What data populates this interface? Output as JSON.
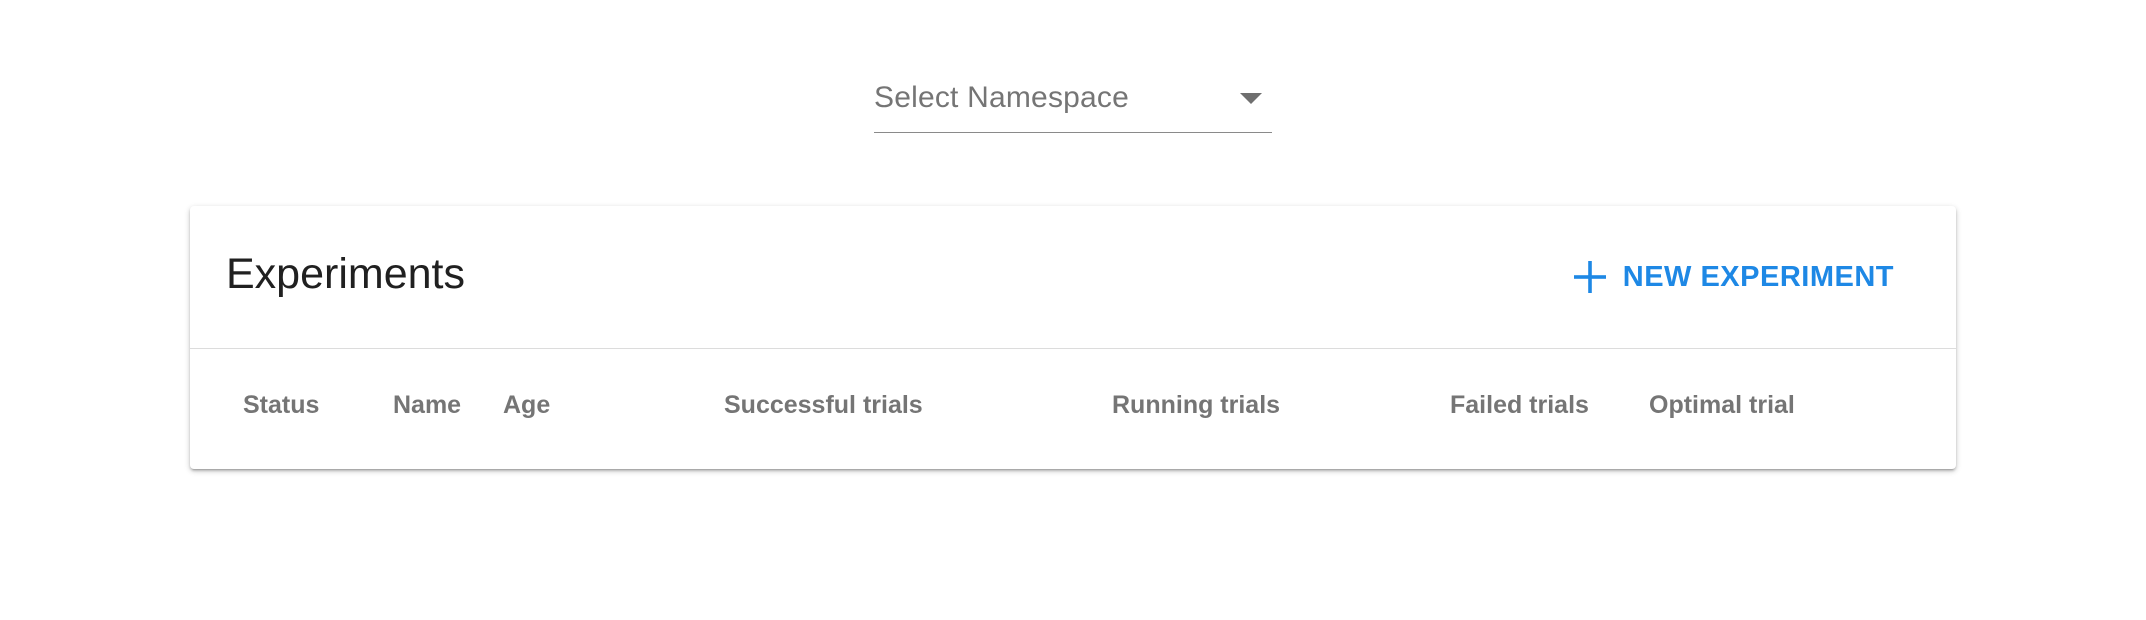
{
  "namespace_select": {
    "placeholder": "Select Namespace",
    "icon": "arrow-drop-down-icon"
  },
  "experiments": {
    "title": "Experiments",
    "new_button": {
      "icon": "plus-icon",
      "label": "NEW EXPERIMENT"
    },
    "columns": [
      "Status",
      "Name",
      "Age",
      "Successful trials",
      "Running trials",
      "Failed trials",
      "Optimal trial"
    ],
    "rows": []
  },
  "colors": {
    "accent": "#1e88e5",
    "header_text": "#757575",
    "title_text": "#202020"
  }
}
